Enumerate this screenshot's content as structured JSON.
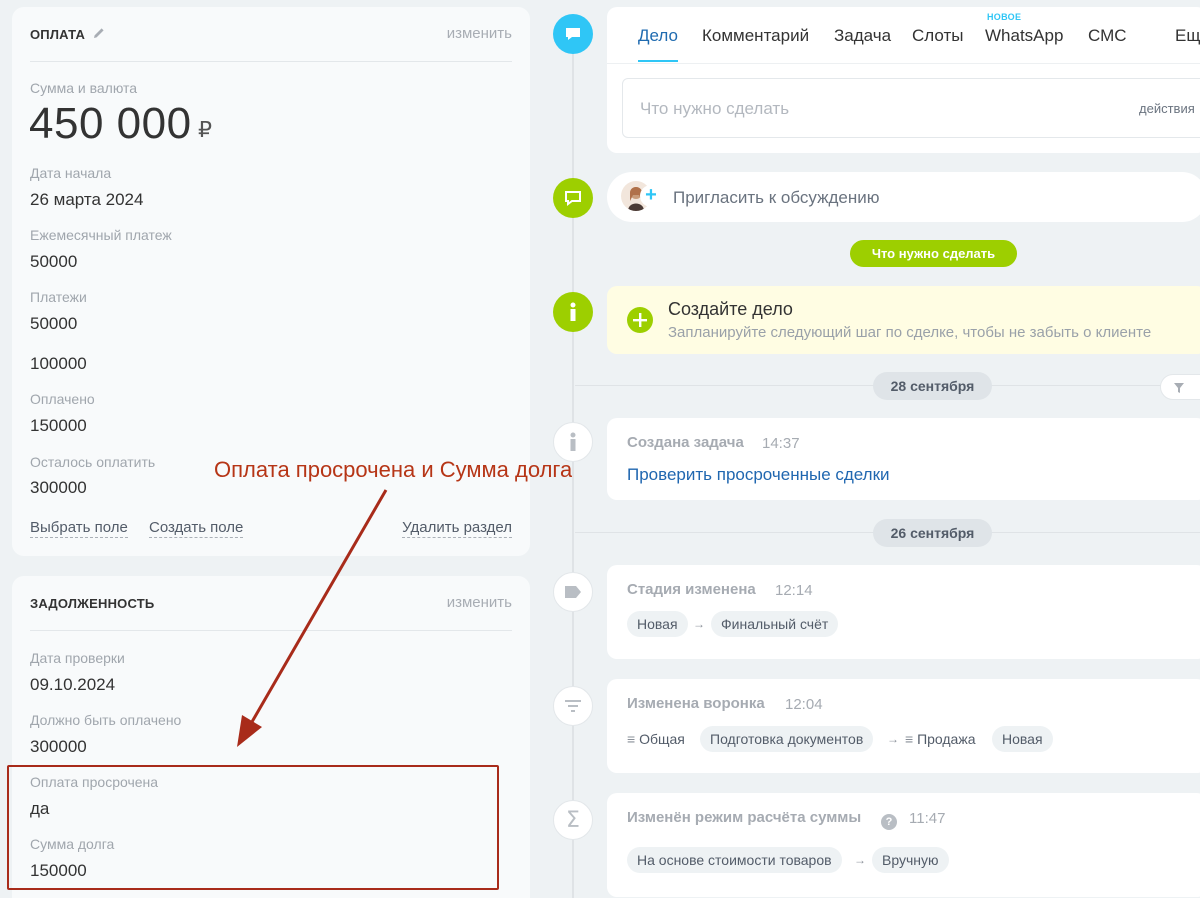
{
  "payment_card": {
    "title": "ОПЛАТА",
    "edit": "изменить",
    "fields": [
      {
        "label": "Сумма и валюта",
        "value": "450 000",
        "currency": "₽"
      },
      {
        "label": "Дата начала",
        "value": "26 марта 2024"
      },
      {
        "label": "Ежемесячный платеж",
        "value": "50000"
      },
      {
        "label": "Платежи",
        "values": [
          "50000",
          "100000"
        ]
      },
      {
        "label": "Оплачено",
        "value": "150000"
      },
      {
        "label": "Осталось оплатить",
        "value": "300000"
      }
    ],
    "footer": {
      "select_field": "Выбрать поле",
      "create_field": "Создать поле",
      "delete_section": "Удалить раздел"
    }
  },
  "debt_card": {
    "title": "ЗАДОЛЖЕННОСТЬ",
    "edit": "изменить",
    "fields": [
      {
        "label": "Дата проверки",
        "value": "09.10.2024"
      },
      {
        "label": "Должно быть оплачено",
        "value": "300000"
      },
      {
        "label": "Оплата просрочена",
        "value": "да"
      },
      {
        "label": "Сумма долга",
        "value": "150000"
      }
    ]
  },
  "annotation": {
    "text": "Оплата просрочена и Сумма долга",
    "color": "#b63516"
  },
  "tabs": {
    "items": [
      "Дело",
      "Комментарий",
      "Задача",
      "Слоты",
      "WhatsApp",
      "СМС",
      "Ещё"
    ],
    "active": "Дело",
    "new_badge": "НОВОЕ",
    "placeholder": "Что нужно сделать",
    "actions": "действия"
  },
  "invite": {
    "text": "Пригласить к обсуждению"
  },
  "todo_pill": "Что нужно сделать",
  "create_deal": {
    "title": "Создайте дело",
    "subtitle": "Запланируйте следующий шаг по сделке, чтобы не забыть о клиенте"
  },
  "dates": [
    "28 сентября",
    "26 сентября"
  ],
  "events": [
    {
      "title": "Создана задача",
      "time": "14:37",
      "link": "Проверить просроченные сделки"
    },
    {
      "title": "Стадия изменена",
      "time": "12:14",
      "from": "Новая",
      "to": "Финальный счёт"
    },
    {
      "title": "Изменена воронка",
      "time": "12:04",
      "from_funnel": "Общая",
      "from_stage": "Подготовка документов",
      "to_funnel": "Продажа",
      "to_stage": "Новая"
    },
    {
      "title": "Изменён режим расчёта суммы",
      "time": "11:47",
      "from": "На основе стоимости товаров",
      "to": "Вручную"
    }
  ],
  "colors": {
    "accent_blue": "#2fc6f6",
    "accent_green": "#9dcf00",
    "link": "#2067b0",
    "annotation": "#b63516"
  }
}
